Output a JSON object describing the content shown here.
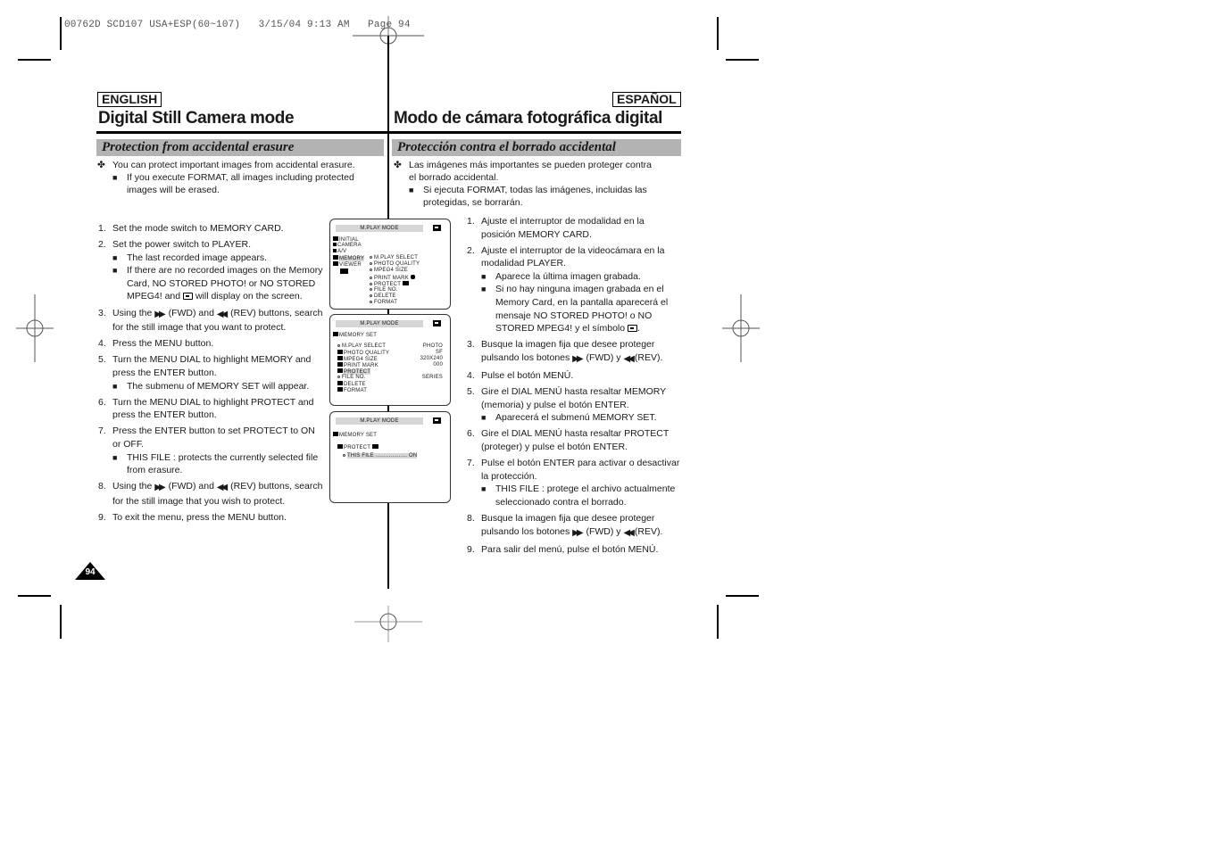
{
  "header": {
    "slug": "00762D SCD107 USA+ESP(60~107)   3/15/04 9:13 AM   Page 94"
  },
  "english": {
    "lang_label": "ENGLISH",
    "title": "Digital Still Camera mode",
    "section": "Protection from accidental erasure",
    "intro": "You can protect important images from accidental erasure.",
    "intro_note": "If you execute FORMAT, all images including protected images will be erased.",
    "steps": [
      {
        "n": "1.",
        "text": "Set the mode switch to MEMORY CARD."
      },
      {
        "n": "2.",
        "text": "Set the power switch to PLAYER.",
        "notes": [
          "The last recorded image appears.",
          "If there are no recorded images on the Memory Card, NO STORED PHOTO! or NO STORED MPEG4! and",
          "will display on the screen."
        ]
      },
      {
        "n": "3.",
        "a": "Using the",
        "b": "(FWD) and",
        "c": "(REV) buttons, search for the still image that you want to protect."
      },
      {
        "n": "4.",
        "text": "Press the MENU button."
      },
      {
        "n": "5.",
        "text": "Turn the MENU DIAL to highlight MEMORY and press the ENTER button.",
        "notes": [
          "The submenu of MEMORY SET will appear."
        ]
      },
      {
        "n": "6.",
        "text": "Turn the MENU DIAL to highlight PROTECT and press the ENTER button."
      },
      {
        "n": "7.",
        "text": "Press the ENTER button to set PROTECT to ON or OFF.",
        "notes": [
          "THIS FILE : protects the currently selected file from erasure."
        ]
      },
      {
        "n": "8.",
        "a": "Using the",
        "b": "(FWD) and",
        "c": "(REV) buttons, search for the still image that you wish to protect."
      },
      {
        "n": "9.",
        "text": "To exit the menu, press the MENU button."
      }
    ]
  },
  "spanish": {
    "lang_label": "ESPAÑOL",
    "title": "Modo de cámara fotográfica digital",
    "section": "Protección contra el borrado accidental",
    "intro": "Las imágenes más importantes se pueden proteger contra el borrado accidental.",
    "intro_note": "Si ejecuta FORMAT, todas las imágenes, incluidas las protegidas, se borrarán.",
    "steps": [
      {
        "n": "1.",
        "text": "Ajuste el interruptor de modalidad en la posición MEMORY CARD."
      },
      {
        "n": "2.",
        "text": "Ajuste el interruptor de la videocámara en la modalidad PLAYER.",
        "notes": [
          "Aparece la última imagen grabada.",
          "Si no hay ninguna imagen grabada en el Memory Card, en la pantalla aparecerá el mensaje NO STORED PHOTO! o NO STORED MPEG4! y el símbolo"
        ]
      },
      {
        "n": "3.",
        "a": "Busque la imagen fija que desee proteger pulsando los botones",
        "b": "(FWD) y",
        "c": "(REV)."
      },
      {
        "n": "4.",
        "text": "Pulse el botón MENÚ."
      },
      {
        "n": "5.",
        "text": "Gire el DIAL MENÚ hasta resaltar MEMORY (memoria) y pulse el botón ENTER.",
        "notes": [
          "Aparecerá el submenú MEMORY SET."
        ]
      },
      {
        "n": "6.",
        "text": "Gire el DIAL MENÚ hasta resaltar PROTECT (proteger) y pulse el botón ENTER."
      },
      {
        "n": "7.",
        "text": "Pulse el botón ENTER para activar o desactivar la protección.",
        "notes": [
          "THIS FILE : protege el archivo actualmente seleccionado contra el borrado."
        ]
      },
      {
        "n": "8.",
        "a": "Busque la imagen fija que desee proteger pulsando los botones",
        "b": "(FWD) y",
        "c": "(REV)."
      },
      {
        "n": "9.",
        "text": "Para salir del menú, pulse el botón MENÚ."
      }
    ]
  },
  "screens": [
    {
      "title": "M.PLAY MODE",
      "left": [
        "INITIAL",
        "CAMERA",
        "A/V",
        "MEMORY",
        "VIEWER"
      ],
      "right": [
        "M.PLAY SELECT",
        "PHOTO QUALITY",
        "MPEG4 SIZE",
        "PRINT MARK",
        "PROTECT",
        "FILE NO.",
        "DELETE",
        "FORMAT"
      ]
    },
    {
      "title": "M.PLAY MODE",
      "heading": "MEMORY SET",
      "rows": [
        {
          "label": "M.PLAY SELECT",
          "dots": "............",
          "value": "PHOTO"
        },
        {
          "label": "PHOTO QUALITY",
          "dots": "..................",
          "value": "SF"
        },
        {
          "label": "MPEG4 SIZE",
          "dots": ".............",
          "value": "320X240"
        },
        {
          "label": "PRINT MARK",
          "dots": "................",
          "value": "000"
        },
        {
          "label": "PROTECT",
          "dots": "",
          "value": ""
        },
        {
          "label": "FILE NO.",
          "dots": ".......................",
          "value": "SERIES"
        },
        {
          "label": "DELETE",
          "dots": "",
          "value": ""
        },
        {
          "label": "FORMAT",
          "dots": "",
          "value": ""
        }
      ]
    },
    {
      "title": "M.PLAY MODE",
      "heading": "MEMORY SET",
      "sub": "PROTECT",
      "row": {
        "label": "THIS FILE",
        "dots": "...................",
        "value": "ON"
      }
    }
  ],
  "glyphs": {
    "cross": "✤",
    "square": "■",
    "fwd": "▶▶",
    "rev": "◀◀"
  },
  "page_number": "94"
}
